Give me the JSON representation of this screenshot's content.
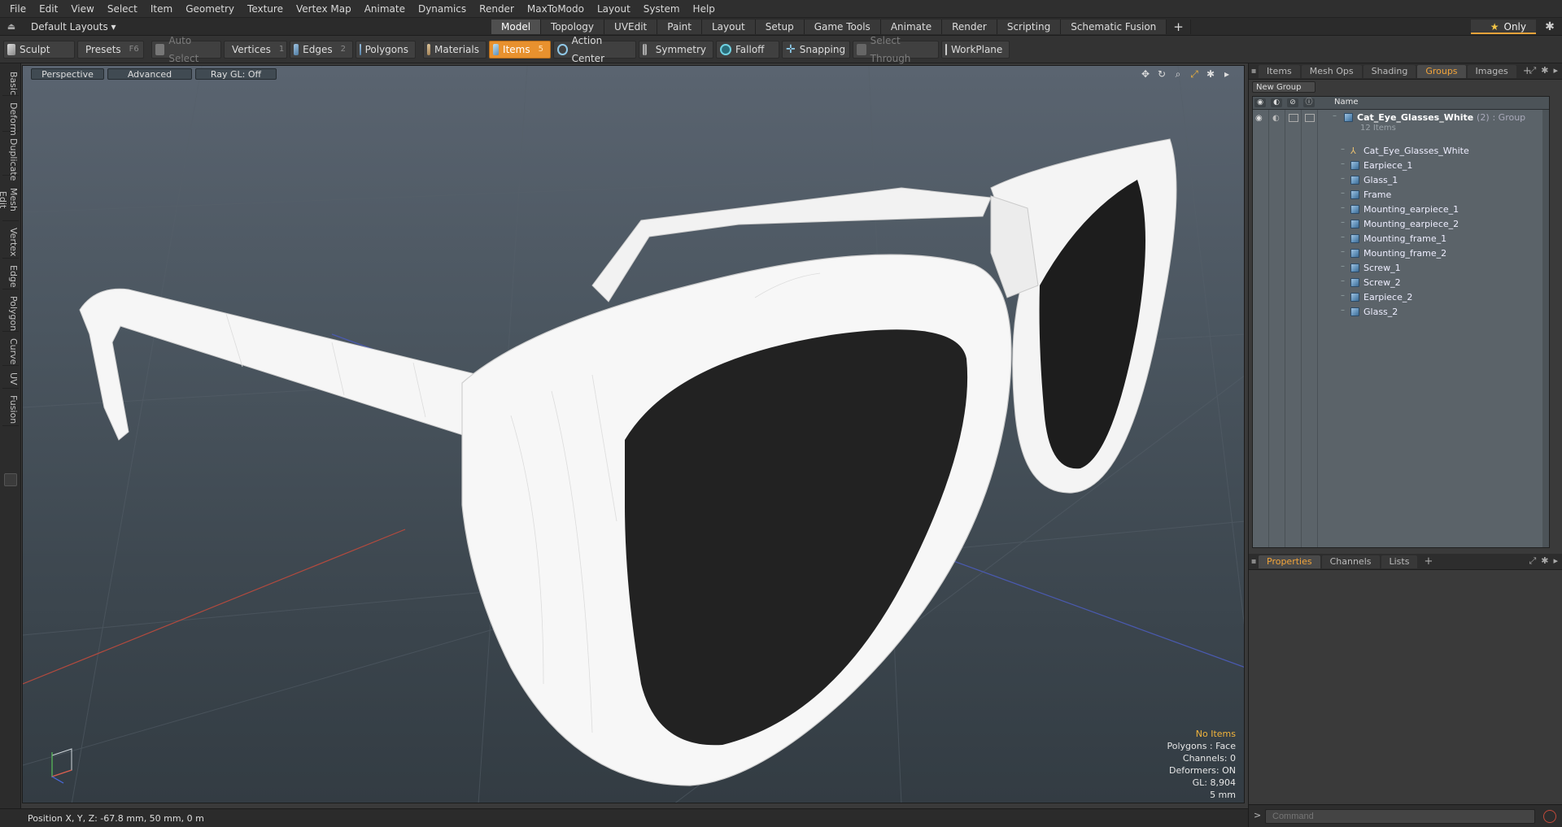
{
  "menu": [
    "File",
    "Edit",
    "View",
    "Select",
    "Item",
    "Geometry",
    "Texture",
    "Vertex Map",
    "Animate",
    "Dynamics",
    "Render",
    "MaxToModo",
    "Layout",
    "System",
    "Help"
  ],
  "layout": {
    "layouts_label": "Default Layouts ▾",
    "tabs": [
      "Model",
      "Topology",
      "UVEdit",
      "Paint",
      "Layout",
      "Setup",
      "Game Tools",
      "Animate",
      "Render",
      "Scripting",
      "Schematic Fusion"
    ],
    "active_tab": "Model",
    "plus": "+",
    "only_label": "Only"
  },
  "toolbar": {
    "sculpt": "Sculpt",
    "presets": "Presets",
    "presets_key": "F6",
    "auto_select": "Auto Select",
    "vertices": "Vertices",
    "vertices_key": "1",
    "edges": "Edges",
    "edges_key": "2",
    "polygons": "Polygons",
    "materials": "Materials",
    "items": "Items",
    "items_key": "5",
    "action_center": "Action Center",
    "symmetry": "Symmetry",
    "falloff": "Falloff",
    "snapping": "Snapping",
    "select_through": "Select Through",
    "workplane": "WorkPlane"
  },
  "left_tabs": [
    "Basic",
    "Deform",
    "Duplicate",
    "Mesh Edit",
    "Vertex",
    "Edge",
    "Polygon",
    "Curve",
    "UV",
    "Fusion"
  ],
  "viewport": {
    "view_mode": "Perspective",
    "shading": "Advanced",
    "raygl": "Ray GL: Off",
    "hud": {
      "items": "No Items",
      "polygons": "Polygons : Face",
      "channels": "Channels: 0",
      "deformers": "Deformers: ON",
      "gl": "GL: 8,904",
      "units": "5 mm"
    }
  },
  "status": {
    "position": "Position X, Y, Z:   -67.8 mm, 50 mm, 0 m"
  },
  "right_panel": {
    "tabs": [
      "Items",
      "Mesh Ops",
      "Shading",
      "Groups",
      "Images"
    ],
    "active_tab": "Groups",
    "new_group": "New Group",
    "name_header": "Name",
    "group": {
      "name": "Cat_Eye_Glasses_White",
      "count": "(2)",
      "type": ": Group",
      "sub": "12 Items"
    },
    "items": [
      "Cat_Eye_Glasses_White",
      "Earpiece_1",
      "Glass_1",
      "Frame",
      "Mounting_earpiece_1",
      "Mounting_earpiece_2",
      "Mounting_frame_1",
      "Mounting_frame_2",
      "Screw_1",
      "Screw_2",
      "Earpiece_2",
      "Glass_2"
    ],
    "prop_tabs": [
      "Properties",
      "Channels",
      "Lists"
    ],
    "active_prop_tab": "Properties",
    "command_placeholder": "Command"
  }
}
